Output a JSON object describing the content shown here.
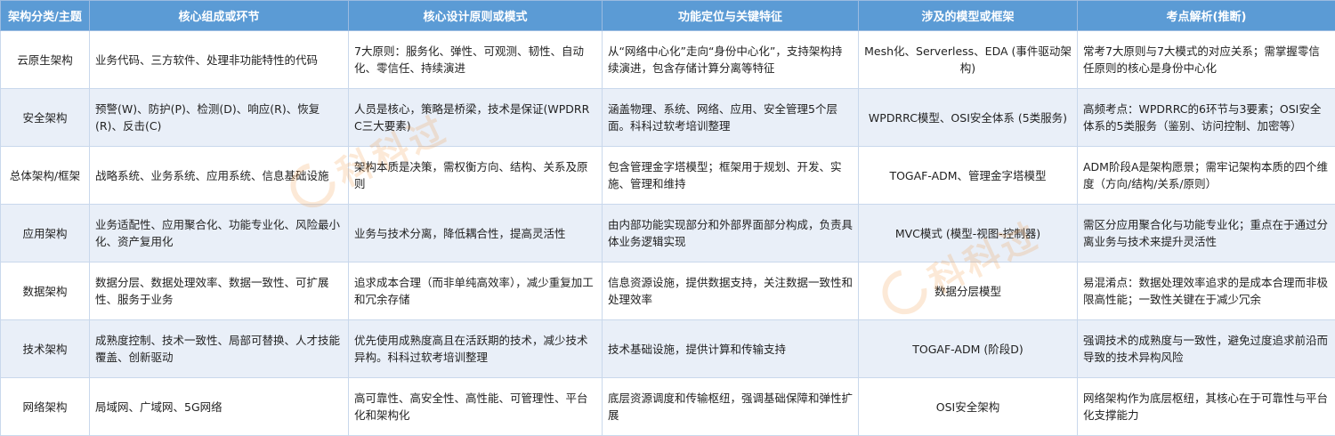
{
  "headers": [
    "架构分类/主题",
    "核心组成或环节",
    "核心设计原则或模式",
    "功能定位与关键特征",
    "涉及的模型或框架",
    "考点解析(推断)"
  ],
  "rows": [
    {
      "category": "云原生架构",
      "components": "业务代码、三方软件、处理非功能特性的代码",
      "principles": "7大原则：服务化、弹性、可观测、韧性、自动化、零信任、持续演进",
      "features": "从“网络中心化”走向“身份中心化”，支持架构持续演进，包含存储计算分离等特征",
      "models": "Mesh化、Serverless、EDA (事件驱动架构)",
      "analysis": "常考7大原则与7大模式的对应关系；需掌握零信任原则的核心是身份中心化"
    },
    {
      "category": "安全架构",
      "components": "预警(W)、防护(P)、检测(D)、响应(R)、恢复(R)、反击(C)",
      "principles": "人员是核心，策略是桥梁，技术是保证(WPDRRC三大要素)",
      "features": "涵盖物理、系统、网络、应用、安全管理5个层面。科科过软考培训整理",
      "models": "WPDRRC模型、OSI安全体系 (5类服务)",
      "analysis": "高频考点：WPDRRC的6环节与3要素；OSI安全体系的5类服务（鉴别、访问控制、加密等）"
    },
    {
      "category": "总体架构/框架",
      "components": "战略系统、业务系统、应用系统、信息基础设施",
      "principles": "架构本质是决策，需权衡方向、结构、关系及原则",
      "features": "包含管理金字塔模型；框架用于规划、开发、实施、管理和维持",
      "models": "TOGAF-ADM、管理金字塔模型",
      "analysis": "ADM阶段A是架构愿景；需牢记架构本质的四个维度（方向/结构/关系/原则）"
    },
    {
      "category": "应用架构",
      "components": "业务适配性、应用聚合化、功能专业化、风险最小化、资产复用化",
      "principles": "业务与技术分离，降低耦合性，提高灵活性",
      "features": "由内部功能实现部分和外部界面部分构成，负责具体业务逻辑实现",
      "models": "MVC模式 (模型-视图-控制器)",
      "analysis": "需区分应用聚合化与功能专业化；重点在于通过分离业务与技术来提升灵活性"
    },
    {
      "category": "数据架构",
      "components": "数据分层、数据处理效率、数据一致性、可扩展性、服务于业务",
      "principles": "追求成本合理（而非单纯高效率），减少重复加工和冗余存储",
      "features": "信息资源设施，提供数据支持，关注数据一致性和处理效率",
      "models": "数据分层模型",
      "analysis": "易混淆点：数据处理效率追求的是成本合理而非极限高性能；一致性关键在于减少冗余"
    },
    {
      "category": "技术架构",
      "components": "成熟度控制、技术一致性、局部可替换、人才技能覆盖、创新驱动",
      "principles": "优先使用成熟度高且在活跃期的技术，减少技术异构。科科过软考培训整理",
      "features": "技术基础设施，提供计算和传输支持",
      "models": "TOGAF-ADM (阶段D)",
      "analysis": "强调技术的成熟度与一致性，避免过度追求前沿而导致的技术异构风险"
    },
    {
      "category": "网络架构",
      "components": "局域网、广域网、5G网络",
      "principles": "高可靠性、高安全性、高性能、可管理性、平台化和架构化",
      "features": "底层资源调度和传输枢纽，强调基础保障和弹性扩展",
      "models": "OSI安全架构",
      "analysis": "网络架构作为底层枢纽，其核心在于可靠性与平台化支撑能力"
    }
  ],
  "watermark": {
    "text": "科科过"
  }
}
